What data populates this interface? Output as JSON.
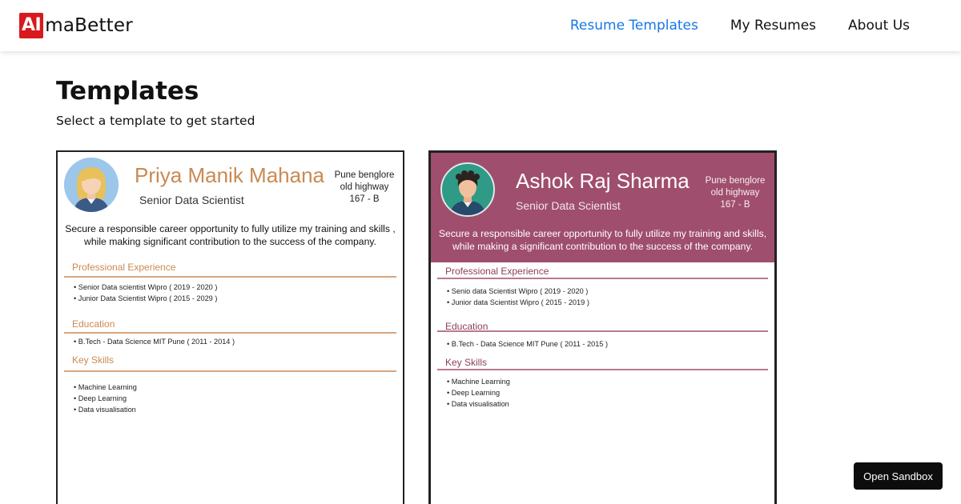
{
  "header": {
    "logo_badge": "AI",
    "logo_text": "maBetter",
    "nav": [
      {
        "label": "Resume Templates",
        "active": true
      },
      {
        "label": "My Resumes",
        "active": false
      },
      {
        "label": "About Us",
        "active": false
      }
    ]
  },
  "page": {
    "title": "Templates",
    "subtitle": "Select a template to get started"
  },
  "templates": [
    {
      "name": "Priya Manik Mahana",
      "role": "Senior Data Scientist",
      "address": [
        "Pune benglore",
        "old highway",
        "167 - B"
      ],
      "objective": "Secure a responsible career opportunity to fully utilize my training and skills , while making significant contribution to the success of the company.",
      "sections": [
        {
          "title": "Professional Experience",
          "items": [
            "Senior Data scientist Wipro ( 2019 - 2020 )",
            "Junior Data Scientist Wipro ( 2015 - 2029 )"
          ]
        },
        {
          "title": "Education",
          "items": [
            "B.Tech - Data Science MIT Pune ( 2011 - 2014 )"
          ]
        },
        {
          "title": "Key Skills",
          "items": [
            "Machine Learning",
            "Deep Learning",
            "Data visualisation"
          ]
        }
      ],
      "accent": "#c98a52"
    },
    {
      "name": "Ashok Raj Sharma",
      "role": "Senior Data Scientist",
      "address": [
        "Pune benglore",
        "old highway",
        "167 - B"
      ],
      "objective": "Secure a responsible career opportunity to fully utilize my training and skills, while making a significant contribution to the success of the company.",
      "sections": [
        {
          "title": "Professional Experience",
          "items": [
            "Senio data Scientist Wipro ( 2019 - 2020 )",
            "Junior data Scientist Wipro ( 2015 - 2019 )"
          ]
        },
        {
          "title": "Education",
          "items": [
            "B.Tech - Data Science MIT Pune ( 2011 - 2015 )"
          ]
        },
        {
          "title": "Key Skills",
          "items": [
            "Machine Learning",
            "Deep Learning",
            "Data visualisation"
          ]
        }
      ],
      "accent": "#a04e6d"
    }
  ],
  "sandbox": {
    "label": "Open Sandbox"
  },
  "icons": {
    "avatar_1": "female-avatar-icon",
    "avatar_2": "male-avatar-icon"
  }
}
